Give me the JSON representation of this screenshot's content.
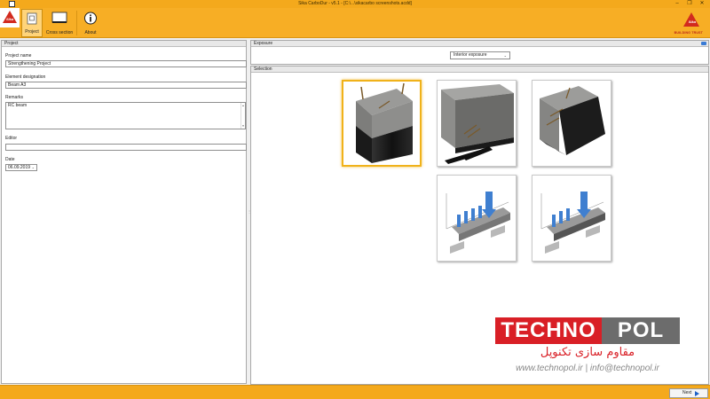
{
  "window": {
    "title": "Sika CarboDur - v5.1 - [C:\\...\\sikacarbo screenshots.acdd]",
    "controls": [
      "–",
      "❐",
      "✕"
    ]
  },
  "ribbon": {
    "buttons": [
      {
        "label": "Project",
        "icon": "project-icon",
        "active": true
      },
      {
        "label": "Cross section",
        "icon": "cross-section-icon",
        "active": false
      },
      {
        "label": "About",
        "icon": "info-icon",
        "active": false
      }
    ],
    "brand_slogan": "BUILDING TRUST",
    "brand_mark": "Sika"
  },
  "project": {
    "header": "Project",
    "project_name_label": "Project name",
    "project_name_value": "Strengthening Project",
    "element_label": "Element designation",
    "element_value": "Beam A3",
    "remarks_label": "Remarks",
    "remarks_value": "RC beam",
    "editor_label": "Editor",
    "editor_value": "",
    "date_label": "Date",
    "date_value": "06.09.2019"
  },
  "exposure": {
    "header": "Exposure",
    "selected": "Interior exposure"
  },
  "selection": {
    "header": "Selection",
    "options": [
      {
        "icon": "beam-bottom-strip-icon",
        "selected": true
      },
      {
        "icon": "beam-bottom-laminates-icon",
        "selected": false
      },
      {
        "icon": "beam-side-wrap-icon",
        "selected": false
      },
      {
        "icon": "slab-strips-load-icon",
        "selected": false
      },
      {
        "icon": "slab-strips-load-alt-icon",
        "selected": false
      }
    ]
  },
  "watermark": {
    "brand_left": "TECHNO",
    "brand_right": "POL",
    "persian": "مقاوم سازی تکنوپل",
    "contact": "www.technopol.ir | info@technopol.ir"
  },
  "footer": {
    "next_label": "Next"
  },
  "colors": {
    "accent": "#f4a91c",
    "sika_red": "#d22a1e",
    "selection_border": "#f0b21a"
  }
}
